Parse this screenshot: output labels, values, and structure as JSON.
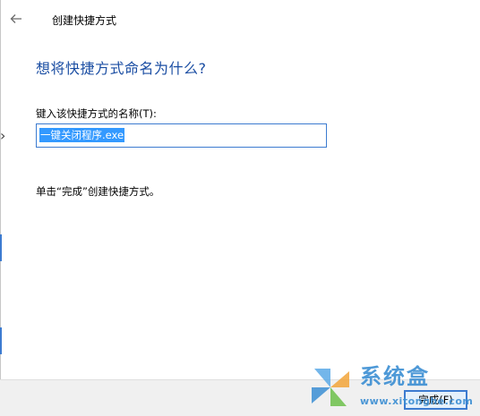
{
  "titlebar": {
    "title": "创建快捷方式",
    "back_icon": "back-arrow-icon"
  },
  "main": {
    "heading": "想将快捷方式命名为什么?",
    "field_label": "键入该快捷方式的名称(T):",
    "name_value": "一键关闭程序.exe",
    "instruction": "单击“完成”创建快捷方式。"
  },
  "footer": {
    "finish_label": "完成(F)"
  },
  "watermark": {
    "brand": "系统盒",
    "url": "www.xitonghe.com",
    "logo_icon": "windmill-logo-icon"
  },
  "colors": {
    "heading": "#1b4ea3",
    "accent": "#3c7bd0",
    "selection": "#3399ff",
    "footer_bg": "#f0f0f0",
    "watermark": "#3b8ed3"
  }
}
